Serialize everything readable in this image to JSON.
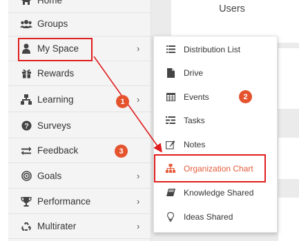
{
  "sidebar": {
    "items": [
      {
        "label": "Home",
        "icon": "home-icon",
        "has_submenu": false
      },
      {
        "label": "Groups",
        "icon": "groups-icon",
        "has_submenu": false
      },
      {
        "label": "My Space",
        "icon": "user-icon",
        "has_submenu": true
      },
      {
        "label": "Rewards",
        "icon": "gift-icon",
        "has_submenu": false
      },
      {
        "label": "Learning",
        "icon": "sitemap-icon",
        "has_submenu": true
      },
      {
        "label": "Surveys",
        "icon": "question-circle-icon",
        "has_submenu": false
      },
      {
        "label": "Feedback",
        "icon": "exchange-icon",
        "has_submenu": false
      },
      {
        "label": "Goals",
        "icon": "bullseye-icon",
        "has_submenu": true
      },
      {
        "label": "Performance",
        "icon": "trophy-icon",
        "has_submenu": true
      },
      {
        "label": "Multirater",
        "icon": "recycle-icon",
        "has_submenu": true
      }
    ],
    "chevron": "›"
  },
  "main": {
    "users_title": "Users"
  },
  "dropdown": {
    "items": [
      {
        "label": "Distribution List",
        "icon": "list-icon"
      },
      {
        "label": "Drive",
        "icon": "file-icon"
      },
      {
        "label": "Events",
        "icon": "calendar-icon"
      },
      {
        "label": "Tasks",
        "icon": "tasks-icon"
      },
      {
        "label": "Notes",
        "icon": "edit-icon"
      },
      {
        "label": "Organization Chart",
        "icon": "sitemap-icon",
        "active": true
      },
      {
        "label": "Knowledge Shared",
        "icon": "book-icon"
      },
      {
        "label": "Ideas Shared",
        "icon": "lightbulb-icon"
      }
    ]
  },
  "annotations": {
    "badge1": "1",
    "badge2": "2",
    "badge3": "3",
    "highlight_color": "#e01b1b",
    "badge_color": "#e5532d",
    "accent_color": "#e35b3a"
  }
}
